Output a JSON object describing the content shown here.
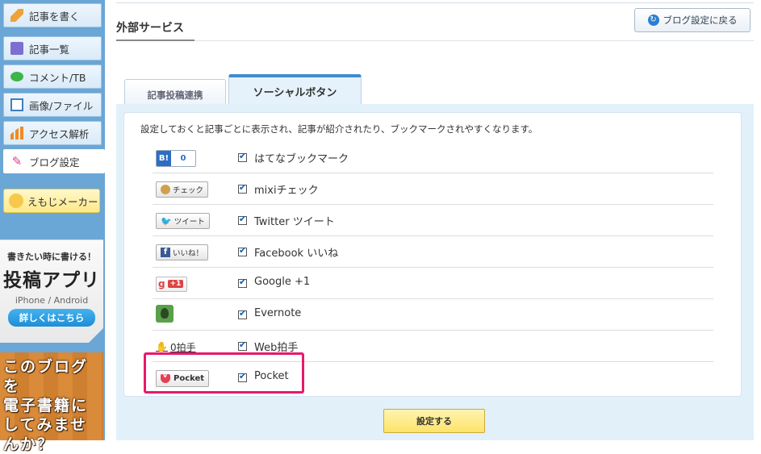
{
  "sidebar": {
    "items": [
      {
        "label": "記事を書く",
        "icon": "pencil-icon"
      },
      {
        "label": "記事一覧",
        "icon": "document-icon"
      },
      {
        "label": "コメント/TB",
        "icon": "speech-bubble-icon"
      },
      {
        "label": "画像/ファイル",
        "icon": "image-icon"
      },
      {
        "label": "アクセス解析",
        "icon": "bar-chart-icon"
      },
      {
        "label": "ブログ設定",
        "icon": "wrench-icon",
        "active": true
      }
    ],
    "emoji_maker": "えもじメーカー",
    "ad_app": {
      "line1": "書きたい時に書ける！",
      "title": "投稿アプリ",
      "sub": "iPhone / Android",
      "button": "詳しくはこちら"
    },
    "ad_ebook": {
      "lines": [
        "このブログを",
        "電子書籍に",
        "してみませ",
        "んか？"
      ]
    }
  },
  "header": {
    "title": "外部サービス",
    "back_button": "ブログ設定に戻る"
  },
  "tabs": [
    {
      "label": "記事投稿連携",
      "active": false
    },
    {
      "label": "ソーシャルボタン",
      "active": true
    }
  ],
  "panel": {
    "description": "設定しておくと記事ごとに表示され、記事が紹介されたり、ブックマークされやすくなります。",
    "services": [
      {
        "label": "はてなブックマーク",
        "checked": true,
        "badge": {
          "prefix": "B!",
          "count": "0"
        }
      },
      {
        "label": "mixiチェック",
        "checked": true,
        "badge": {
          "text": "チェック"
        }
      },
      {
        "label": "Twitter ツイート",
        "checked": true,
        "badge": {
          "text": "ツイート"
        }
      },
      {
        "label": "Facebook いいね",
        "checked": true,
        "badge": {
          "prefix": "f",
          "text": "いいね！"
        }
      },
      {
        "label": "Google +1",
        "checked": true,
        "badge": {
          "g": "g",
          "text": "+1"
        }
      },
      {
        "label": "Evernote",
        "checked": true,
        "badge": {
          "icon": "evernote-icon"
        }
      },
      {
        "label": "Web拍手",
        "checked": true,
        "badge": {
          "text": "0拍手"
        }
      },
      {
        "label": "Pocket",
        "checked": true,
        "badge": {
          "text": "Pocket"
        },
        "highlighted": true
      }
    ],
    "submit": "設定する"
  },
  "colors": {
    "sidebar_bg": "#6aa6d6",
    "tab_accent": "#3f8ccf",
    "highlight": "#e8196b",
    "submit_bg": "#fde36a"
  }
}
